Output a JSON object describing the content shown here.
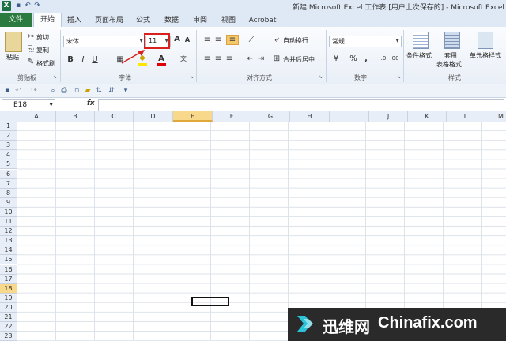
{
  "window": {
    "title": "新建 Microsoft Excel 工作表 [用户上次保存的] - Microsoft Excel"
  },
  "tabs": [
    "文件",
    "开始",
    "插入",
    "页面布局",
    "公式",
    "数据",
    "审阅",
    "视图",
    "Acrobat"
  ],
  "ribbon": {
    "clipboard": {
      "paste": "粘贴",
      "cut": "剪切",
      "copy": "复制",
      "format_painter": "格式刷",
      "label": "剪贴板"
    },
    "font": {
      "name": "宋体",
      "size": "11",
      "bold": "B",
      "italic": "I",
      "underline": "U",
      "label": "字体"
    },
    "alignment": {
      "wrap": "自动换行",
      "merge": "合并后居中",
      "label": "对齐方式"
    },
    "number": {
      "format": "常规",
      "label": "数字",
      "percent": "%",
      "comma": ","
    },
    "styles": {
      "conditional": "条件格式",
      "table1": "套用",
      "table2": "表格格式",
      "cell_styles": "单元格样式",
      "label": "样式"
    }
  },
  "formula_bar": {
    "name_box": "E18",
    "fx": "fx",
    "value": ""
  },
  "columns": [
    "A",
    "B",
    "C",
    "D",
    "E",
    "F",
    "G",
    "H",
    "I",
    "J",
    "K",
    "L",
    "M"
  ],
  "rows": [
    "1",
    "2",
    "3",
    "4",
    "5",
    "6",
    "7",
    "8",
    "9",
    "10",
    "11",
    "12",
    "13",
    "14",
    "15",
    "16",
    "17",
    "18",
    "19",
    "20",
    "21",
    "22",
    "23"
  ],
  "selected_cell": {
    "column": "E",
    "row": "18"
  },
  "watermark": {
    "text1": "迅维网",
    "text2": "Chinafix.com"
  },
  "colors": {
    "file_tab": "#2b7a40",
    "selection_header": "#f8d98b",
    "annotation": "#d9201c"
  }
}
